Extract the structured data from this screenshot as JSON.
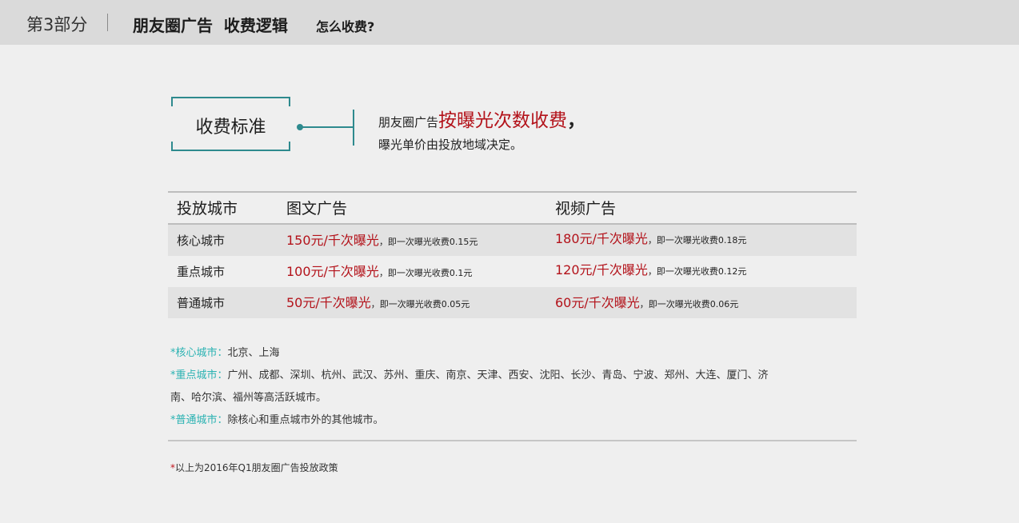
{
  "header": {
    "section": "第3部分",
    "title": "朋友圈广告  收费逻辑",
    "subtitle": "怎么收费?"
  },
  "standard": {
    "label": "收费标准",
    "intro_prefix": "朋友圈广告",
    "intro_highlight": "按曝光次数收费",
    "intro_suffix": "，",
    "intro_line2": "曝光单价由投放地域决定。"
  },
  "table": {
    "headers": [
      "投放城市",
      "图文广告",
      "视频广告"
    ],
    "rows": [
      {
        "city": "核心城市",
        "image_price": "150元/千次曝光",
        "image_note": "，即一次曝光收费0.15元",
        "video_price": "180元/千次曝光",
        "video_note": "，即一次曝光收费0.18元"
      },
      {
        "city": "重点城市",
        "image_price": "100元/千次曝光",
        "image_note": "，即一次曝光收费0.1元",
        "video_price": "120元/千次曝光",
        "video_note": "，即一次曝光收费0.12元"
      },
      {
        "city": "普通城市",
        "image_price": "50元/千次曝光",
        "image_note": "，即一次曝光收费0.05元",
        "video_price": "60元/千次曝光",
        "video_note": "，即一次曝光收费0.06元"
      }
    ]
  },
  "notes": {
    "core_label": "*核心城市：",
    "core_text": "北京、上海",
    "key_label": "*重点城市：",
    "key_text": "广州、成都、深圳、杭州、武汉、苏州、重庆、南京、天津、西安、沈阳、长沙、青岛、宁波、郑州、大连、厦门、济",
    "key_text_2": "南、哈尔滨、福州等高活跃城市。",
    "normal_label": "*普通城市：",
    "normal_text": "除核心和重点城市外的其他城市。"
  },
  "footnote": {
    "star": "*",
    "text": "以上为2016年Q1朋友圈广告投放政策"
  },
  "colors": {
    "accent_teal": "#2e8a8e",
    "note_cyan": "#2ab2b2",
    "price_red": "#b3121a"
  }
}
